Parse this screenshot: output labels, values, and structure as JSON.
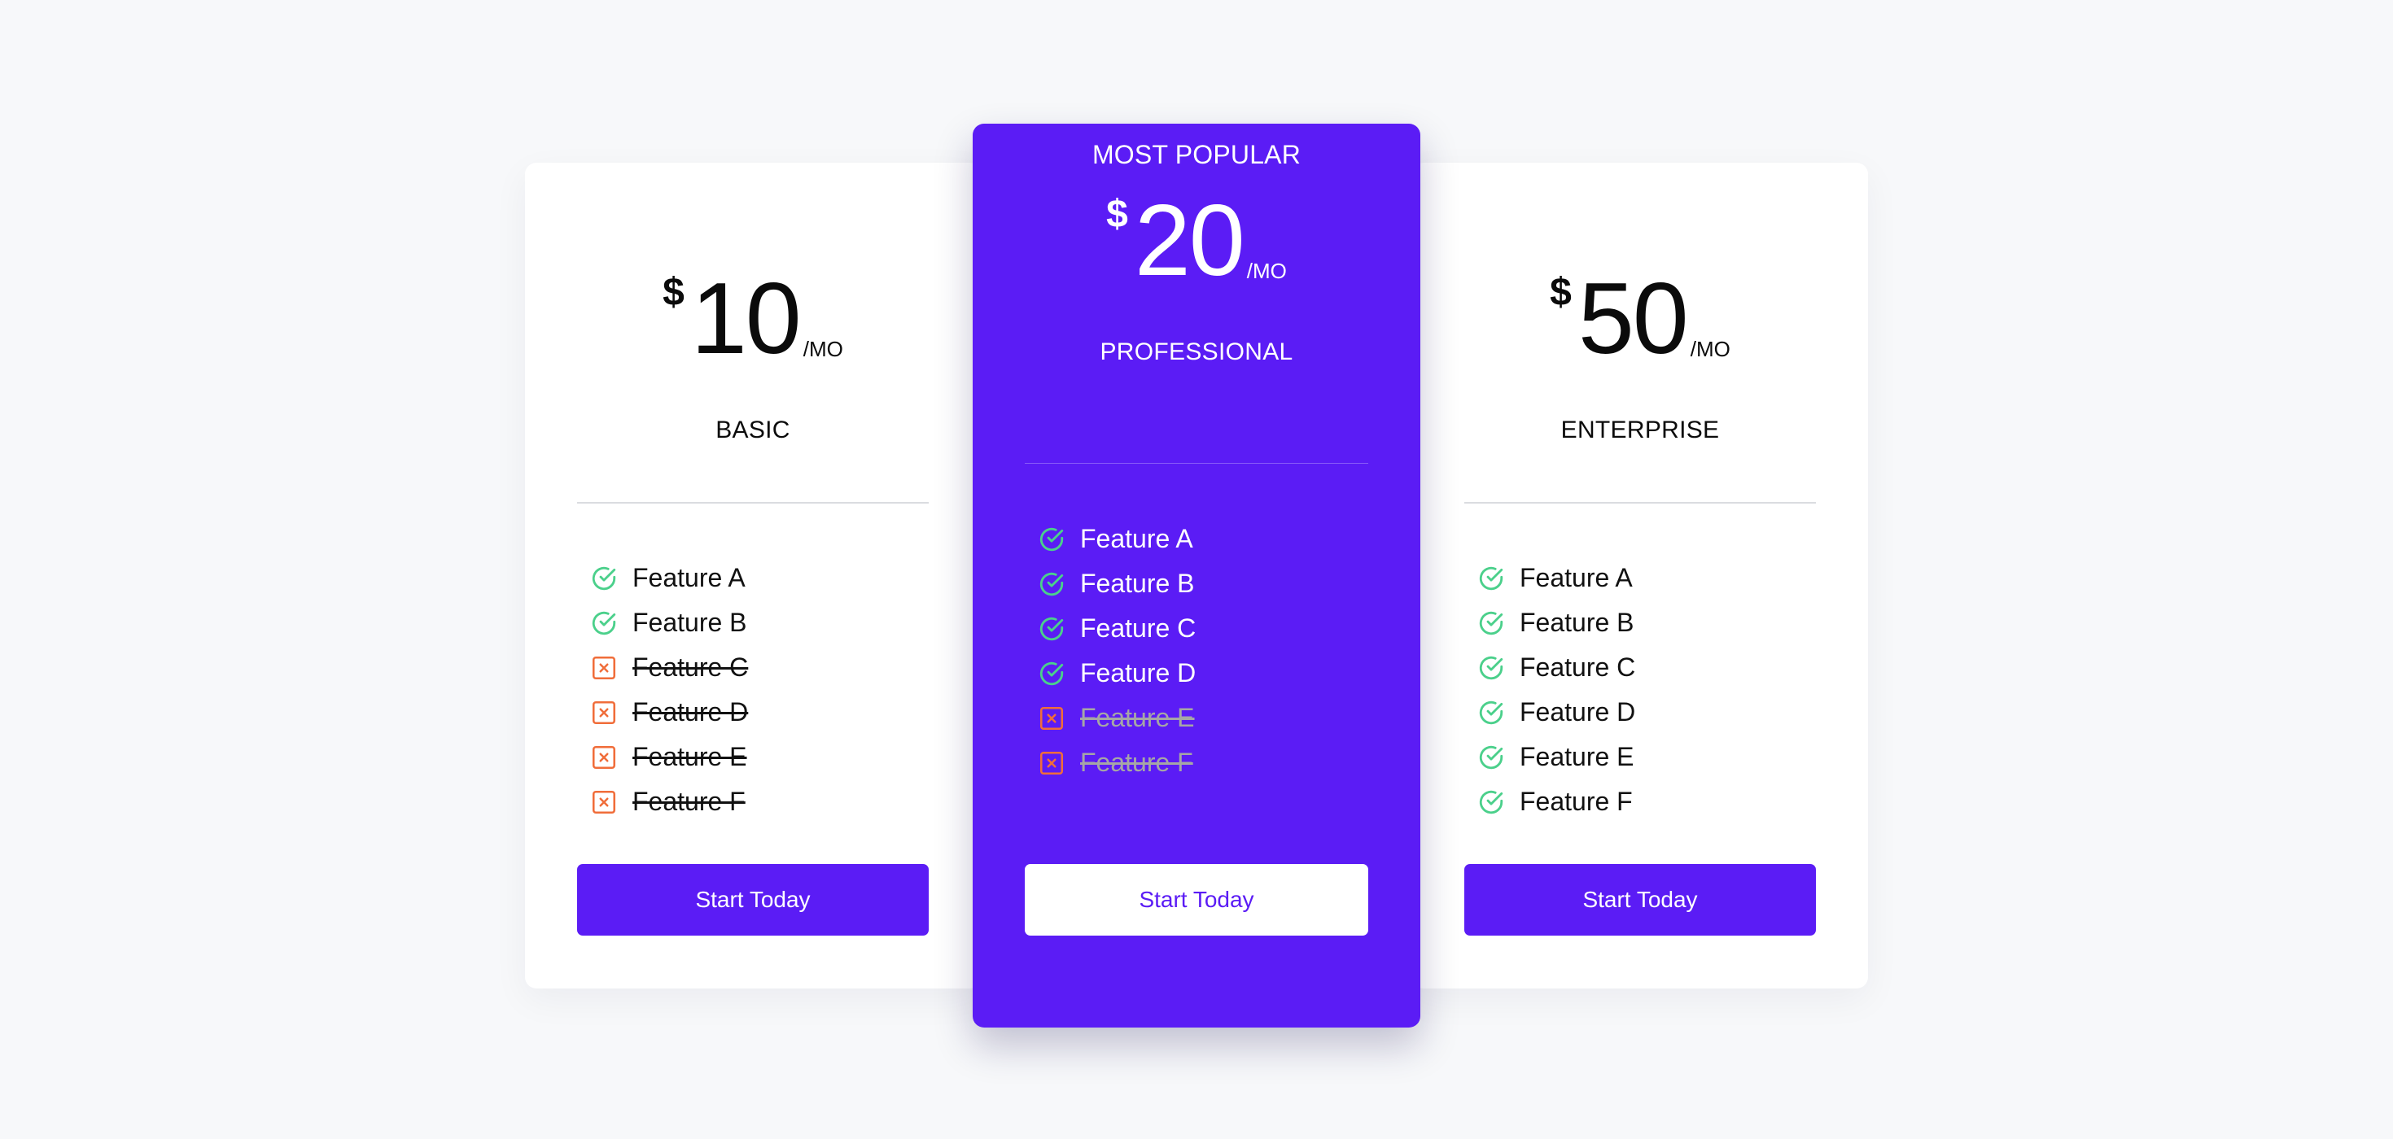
{
  "accent_color": "#5b1cf5",
  "check_color": "#4bd08b",
  "cross_color": "#f06d3a",
  "plans": [
    {
      "name": "BASIC",
      "currency": "$",
      "price": "10",
      "period": "/MO",
      "features": [
        {
          "label": "Feature A",
          "included": true
        },
        {
          "label": "Feature B",
          "included": true
        },
        {
          "label": "Feature C",
          "included": false
        },
        {
          "label": "Feature D",
          "included": false
        },
        {
          "label": "Feature E",
          "included": false
        },
        {
          "label": "Feature F",
          "included": false
        }
      ],
      "cta": "Start Today"
    },
    {
      "badge": "MOST POPULAR",
      "name": "PROFESSIONAL",
      "currency": "$",
      "price": "20",
      "period": "/MO",
      "features": [
        {
          "label": "Feature A",
          "included": true
        },
        {
          "label": "Feature B",
          "included": true
        },
        {
          "label": "Feature C",
          "included": true
        },
        {
          "label": "Feature D",
          "included": true
        },
        {
          "label": "Feature E",
          "included": false
        },
        {
          "label": "Feature F",
          "included": false
        }
      ],
      "cta": "Start Today"
    },
    {
      "name": "ENTERPRISE",
      "currency": "$",
      "price": "50",
      "period": "/MO",
      "features": [
        {
          "label": "Feature A",
          "included": true
        },
        {
          "label": "Feature B",
          "included": true
        },
        {
          "label": "Feature C",
          "included": true
        },
        {
          "label": "Feature D",
          "included": true
        },
        {
          "label": "Feature E",
          "included": true
        },
        {
          "label": "Feature F",
          "included": true
        }
      ],
      "cta": "Start Today"
    }
  ]
}
